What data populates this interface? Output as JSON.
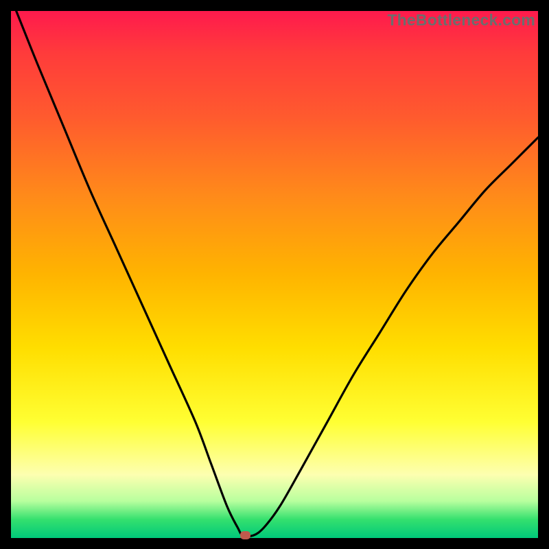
{
  "watermark": "TheBottleneck.com",
  "chart_data": {
    "type": "line",
    "title": "",
    "xlabel": "",
    "ylabel": "",
    "xlim": [
      0,
      100
    ],
    "ylim": [
      0,
      100
    ],
    "grid": false,
    "legend_visible": false,
    "background": "rainbow_vertical_gradient",
    "series": [
      {
        "name": "bottleneck-curve",
        "color": "#000000",
        "x": [
          1,
          5,
          10,
          15,
          20,
          25,
          30,
          35,
          38,
          41,
          43,
          44,
          46,
          48,
          51,
          55,
          60,
          65,
          70,
          75,
          80,
          85,
          90,
          95,
          100
        ],
        "y": [
          100,
          90,
          78,
          66,
          55,
          44,
          33,
          22,
          14,
          6,
          2,
          0.5,
          0.5,
          2,
          6,
          13,
          22,
          31,
          39,
          47,
          54,
          60,
          66,
          71,
          76
        ]
      }
    ],
    "marker": {
      "x": 44.5,
      "y": 0.5,
      "color": "#c05a4d"
    }
  },
  "colors": {
    "frame": "#000000",
    "curve": "#000000",
    "marker": "#c05a4d",
    "gradient_stops": [
      "#ff1a4d",
      "#ff5a2e",
      "#ffb400",
      "#ffff33",
      "#00c97a"
    ]
  }
}
